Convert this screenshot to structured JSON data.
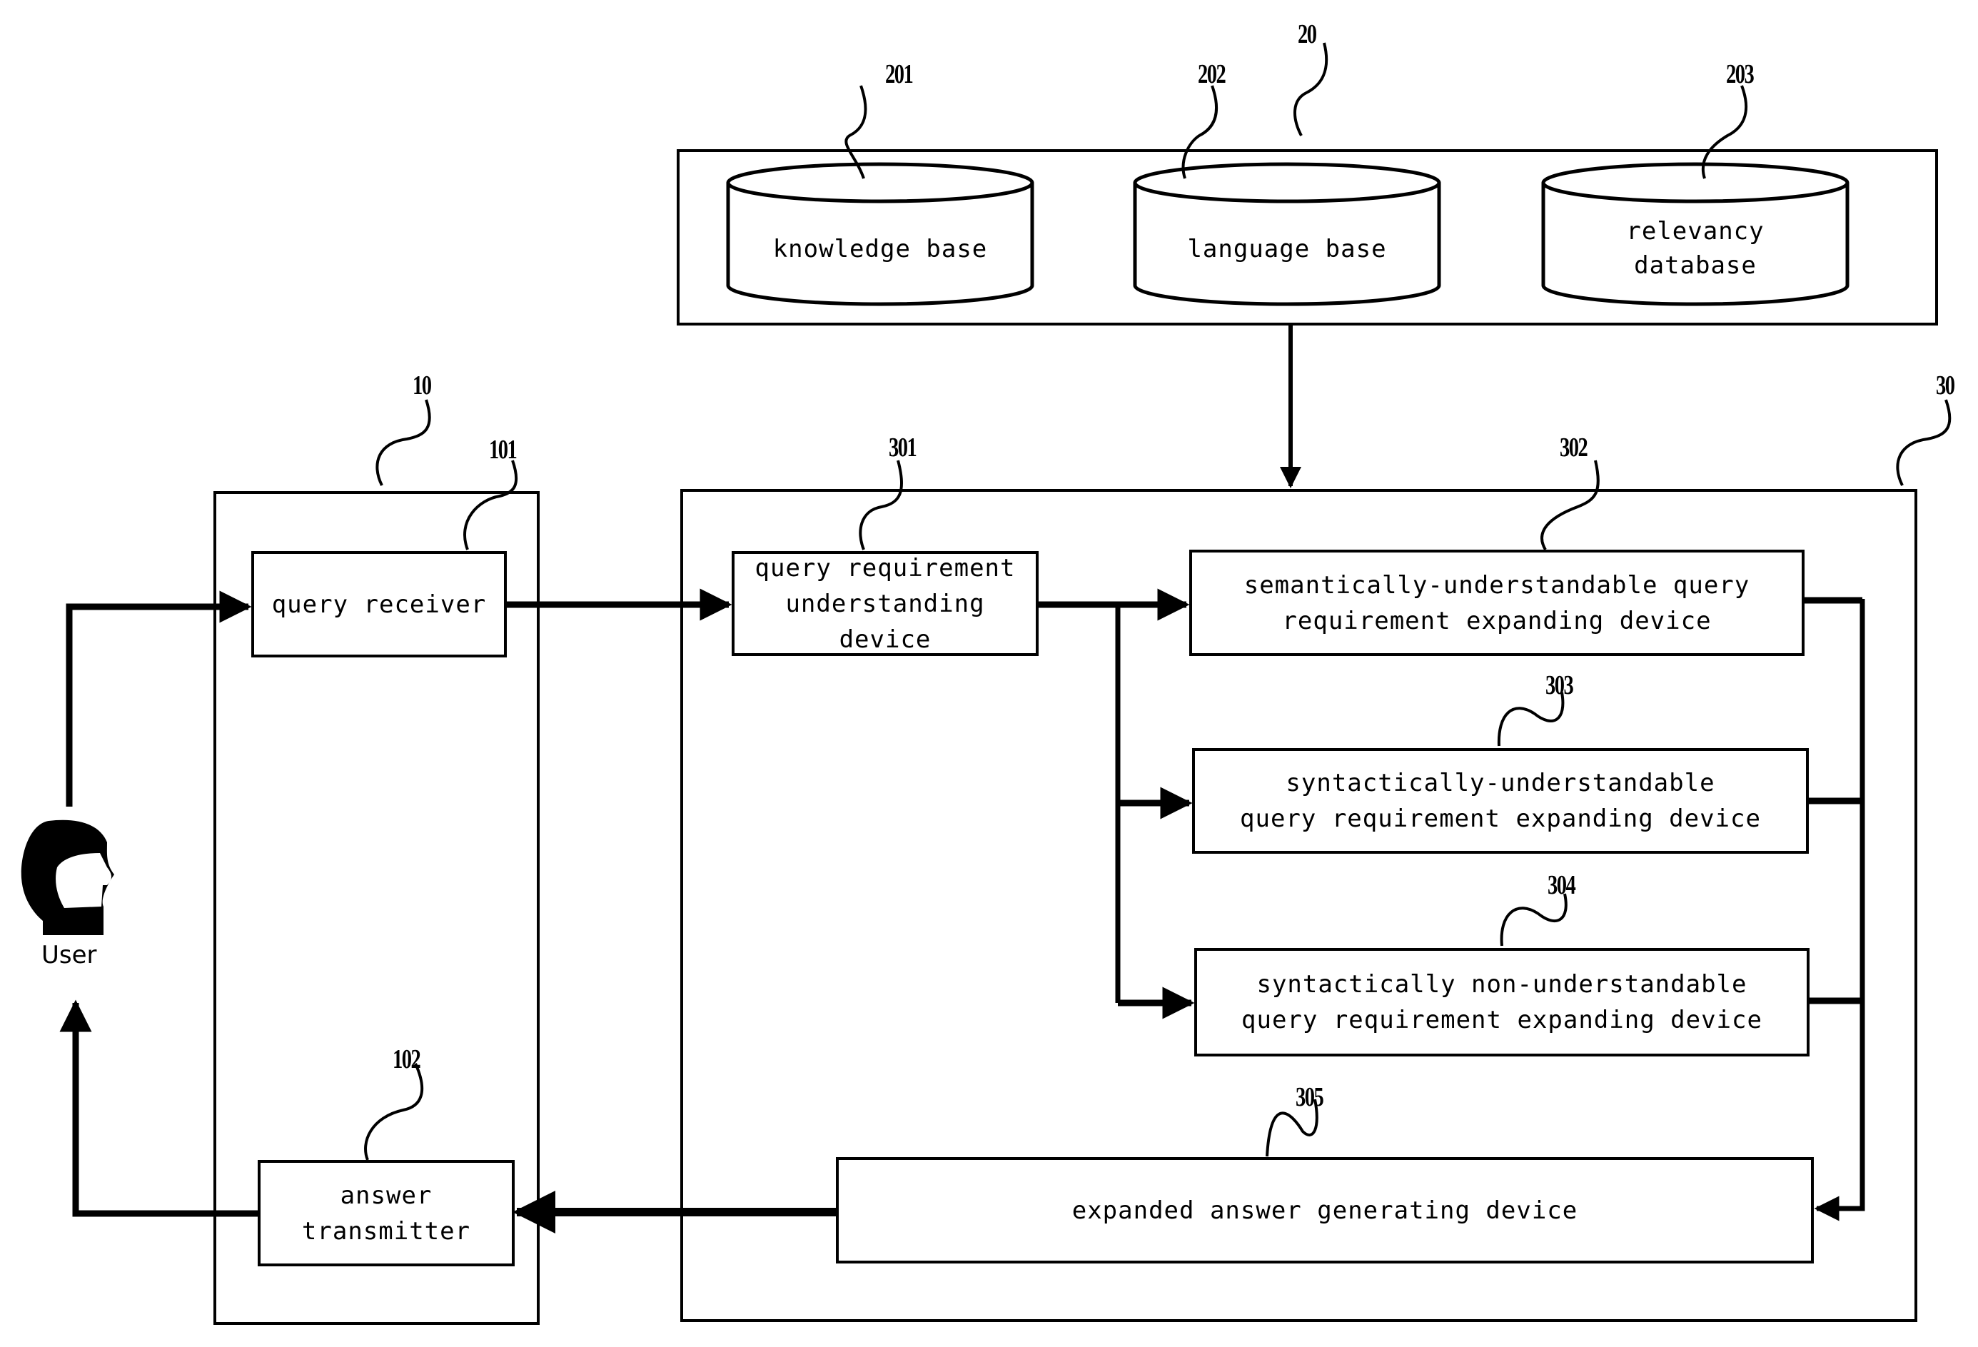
{
  "diagram": {
    "type": "block-diagram",
    "user": {
      "label": "User"
    },
    "groups": {
      "g10": {
        "ref": "10"
      },
      "g20": {
        "ref": "20"
      },
      "g30": {
        "ref": "30"
      }
    },
    "databases": [
      {
        "ref": "201",
        "label": "knowledge base"
      },
      {
        "ref": "202",
        "label": "language base"
      },
      {
        "ref": "203",
        "label": "relevancy\ndatabase"
      }
    ],
    "blocks": {
      "b101": {
        "ref": "101",
        "label": "query receiver"
      },
      "b102": {
        "ref": "102",
        "label": "answer\ntransmitter"
      },
      "b301": {
        "ref": "301",
        "label": "query requirement\nunderstanding device"
      },
      "b302": {
        "ref": "302",
        "label": "semantically-understandable query\nrequirement expanding device"
      },
      "b303": {
        "ref": "303",
        "label": "syntactically-understandable\nquery requirement expanding device"
      },
      "b304": {
        "ref": "304",
        "label": "syntactically non-understandable\nquery requirement expanding device"
      },
      "b305": {
        "ref": "305",
        "label": "expanded answer generating device"
      }
    },
    "connections": [
      {
        "from": "User",
        "to": "query receiver"
      },
      {
        "from": "query receiver",
        "to": "query requirement understanding device"
      },
      {
        "from": "group 20",
        "to": "group 30"
      },
      {
        "from": "query requirement understanding device",
        "to": "semantically-understandable query requirement expanding device"
      },
      {
        "from": "query requirement understanding device",
        "to": "syntactically-understandable query requirement expanding device"
      },
      {
        "from": "query requirement understanding device",
        "to": "syntactically non-understandable query requirement expanding device"
      },
      {
        "from": "expanding devices",
        "to": "expanded answer generating device"
      },
      {
        "from": "expanded answer generating device",
        "to": "answer transmitter"
      },
      {
        "from": "answer transmitter",
        "to": "User"
      }
    ]
  }
}
